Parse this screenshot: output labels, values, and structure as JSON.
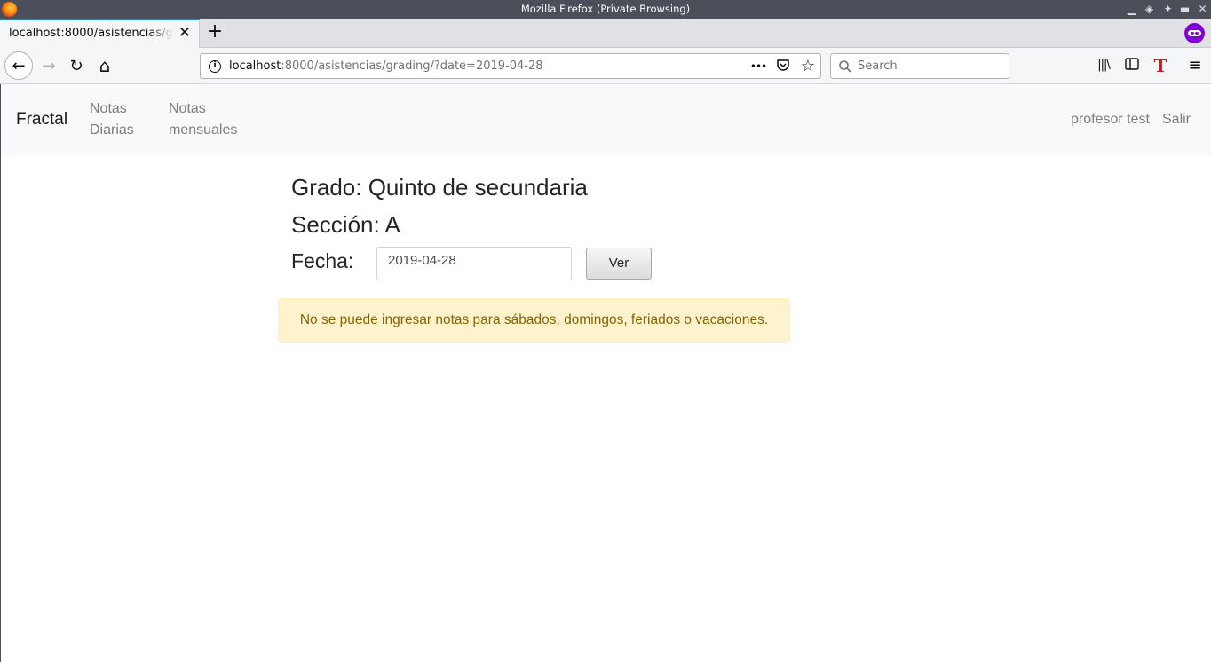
{
  "window": {
    "title": "Mozilla Firefox (Private Browsing)"
  },
  "tab": {
    "label": "localhost:8000/asistencias/grading/?date=2019-04-28",
    "close_glyph": "✕"
  },
  "newtab_glyph": "+",
  "toolbar": {
    "back_glyph": "←",
    "forward_glyph": "→",
    "reload_glyph": "↻",
    "home_glyph": "⌂",
    "url_host": "localhost",
    "url_rest": ":8000/asistencias/grading/?date=2019-04-28",
    "page_actions_glyph": "•••",
    "pocket_glyph": "◡",
    "bookmark_glyph": "☆",
    "search_placeholder": "Search",
    "library_glyph": "|||\\",
    "sidebar_glyph": "▯",
    "translate_glyph": "T",
    "menu_glyph": "≡"
  },
  "site": {
    "brand": "Fractal",
    "nav": [
      {
        "line1": "Notas",
        "line2": "Diarias"
      },
      {
        "line1": "Notas",
        "line2": "mensuales"
      }
    ],
    "user": "profesor test",
    "logout": "Salir"
  },
  "main": {
    "grado": "Grado: Quinto de secundaria",
    "seccion": "Sección: A",
    "fecha_label": "Fecha:",
    "fecha_value": "2019-04-28",
    "ver_button": "Ver",
    "alert": "No se puede ingresar notas para sábados, domingos, feriados o vacaciones."
  },
  "colors": {
    "accent": "#0a84ff",
    "private": "#8000d7",
    "alert_bg": "#fff3cd",
    "alert_text": "#856404"
  }
}
